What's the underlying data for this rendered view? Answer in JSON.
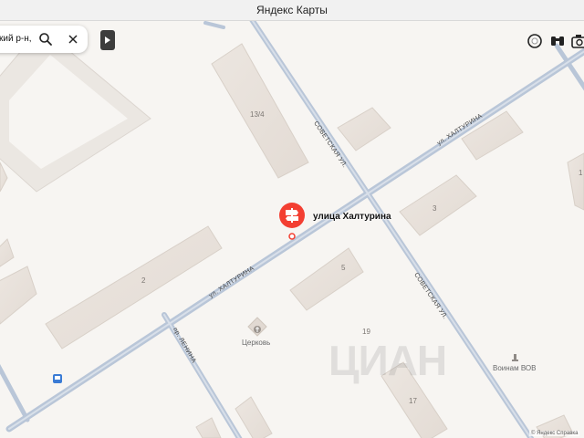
{
  "window": {
    "title": "Яндекс Карты"
  },
  "search": {
    "value": "ский р-н,"
  },
  "pin": {
    "label": "улица Халтурина"
  },
  "streets": {
    "khalturina_upper": "ул. ХАЛТУРИНА",
    "khalturina_lower": "ул. ХАЛТУРИНА",
    "sovetskaya_upper": "СОВЕТСКАЯ УЛ.",
    "sovetskaya_lower": "СОВЕТСКАЯ УЛ.",
    "lenina": "пр. ЛЕНИНА"
  },
  "buildings": {
    "b13_4": "13/4",
    "b3": "3",
    "b2": "2",
    "b5": "5",
    "b19": "19",
    "b17": "17",
    "b1_edge": "1"
  },
  "pois": {
    "church": "Церковь",
    "memorial": "Воинам ВОВ"
  },
  "footer": {
    "copyright": "© Яндекс  Справка"
  },
  "watermark": {
    "text": "ЦИАН"
  },
  "icons": [
    "search-icon",
    "close-icon",
    "triangle-right-icon",
    "layers-icon",
    "binoculars-icon",
    "camera-icon",
    "signpost-icon",
    "church-icon",
    "monument-icon",
    "transit-icon"
  ],
  "colors": {
    "road": "#b9c6d8",
    "building": "#e8e1db",
    "pin": "#f33f32",
    "background": "#f7f5f2"
  }
}
